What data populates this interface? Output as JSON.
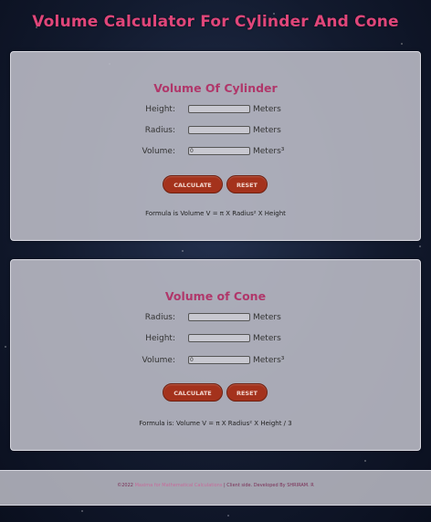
{
  "page_title": "Volume Calculator For Cylinder And Cone",
  "cylinder": {
    "heading": "Volume Of Cylinder",
    "height_label": "Height:",
    "height_value": "",
    "height_unit": "Meters",
    "radius_label": "Radius:",
    "radius_value": "",
    "radius_unit": "Meters",
    "volume_label": "Volume:",
    "volume_value": "0",
    "volume_unit": "Meters³",
    "calculate_label": "CALCULATE",
    "reset_label": "RESET",
    "formula": "Formula is Volume V = π X Radius² X Height"
  },
  "cone": {
    "heading": "Volume of Cone",
    "radius_label": "Radius:",
    "radius_value": "",
    "radius_unit": "Meters",
    "height_label": "Height:",
    "height_value": "",
    "height_unit": "Meters",
    "volume_label": "Volume:",
    "volume_value": "0",
    "volume_unit": "Meters³",
    "calculate_label": "CALCULATE",
    "reset_label": "RESET",
    "formula": "Formula is: Volume V = π X Radius² X Height / 3"
  },
  "footer": {
    "copyright": "©2022",
    "site_link": "Maxima for Mathematical Calculations",
    "rest": " | Client side. Developed By SHRIRAM. R"
  },
  "colors": {
    "title": "#e0467a",
    "heading": "#b0376a",
    "button": "#a4321c"
  }
}
